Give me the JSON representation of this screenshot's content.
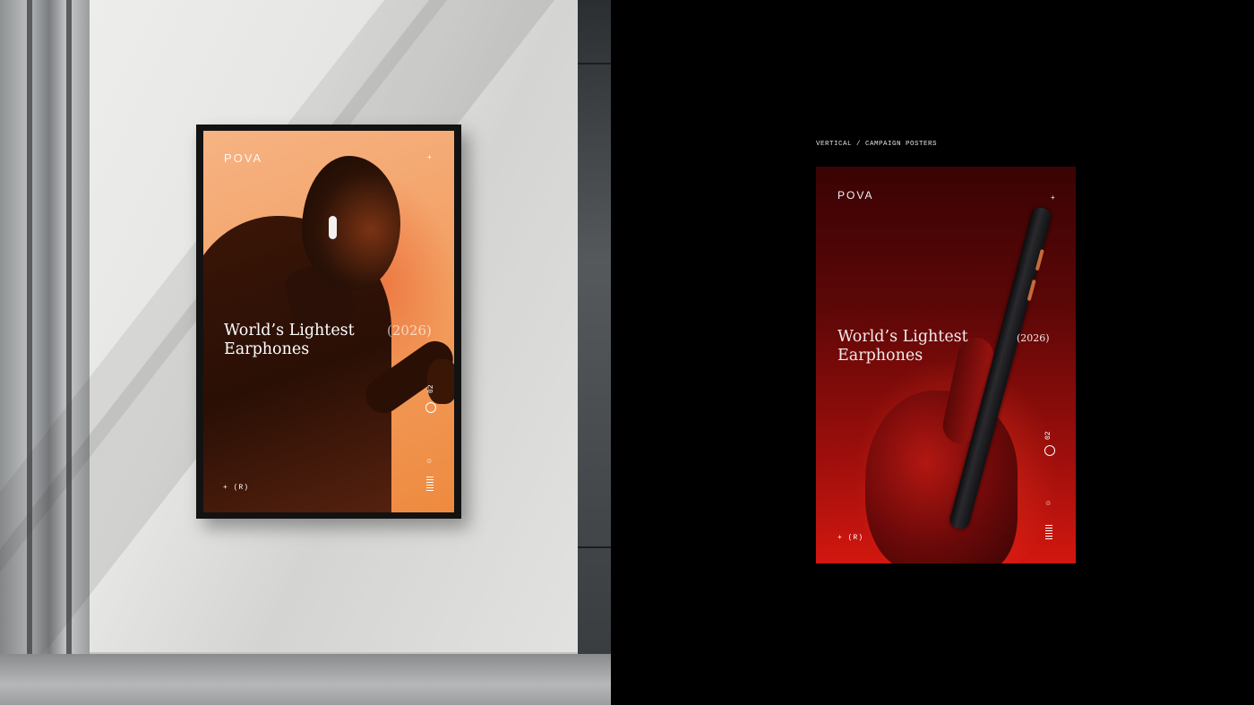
{
  "left_poster": {
    "brand": "POVA",
    "headline_line1": "World’s Lightest",
    "headline_line2": "Earphones",
    "year": "(2026)",
    "footer": "+ (R)",
    "side_number": "02",
    "spark": "+"
  },
  "right_panel": {
    "caption": "VERTICAL / CAMPAIGN POSTERS",
    "poster": {
      "brand": "POVA",
      "headline_line1": "World’s Lightest",
      "headline_line2": "Earphones",
      "year": "(2026)",
      "footer": "+ (R)",
      "side_number": "02",
      "spark": "+"
    }
  },
  "colors": {
    "orange_poster": "#f3a165",
    "red_poster": "#a10f0c",
    "background": "#000000"
  }
}
